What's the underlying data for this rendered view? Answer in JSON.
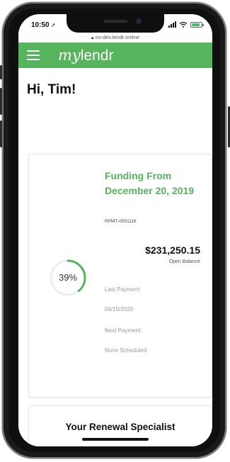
{
  "status_bar": {
    "time": "10:50",
    "url": "os-dev.lendr.online",
    "icons": [
      "location-arrow-icon",
      "signal-icon",
      "wifi-icon",
      "battery-icon"
    ]
  },
  "header": {
    "logo_my": "my",
    "logo_lendr": "lendr",
    "menu_icon": "hamburger-icon",
    "background_color": "#55b45c"
  },
  "greeting": "Hi, Tim!",
  "funding_card": {
    "title": "Funding From December 20, 2019",
    "reference": "RPMT-0051118",
    "amount": "$231,250.15",
    "amount_label": "Open Balance",
    "progress_percent": 39,
    "progress_label": "39%",
    "last_payment_label": "Last Payment:",
    "last_payment_value": "04/15/2020",
    "next_payment_label": "Next Payment:",
    "next_payment_value": "None Scheduled",
    "accent_color": "#55b45c"
  },
  "specialist_card": {
    "title": "Your Renewal Specialist"
  }
}
